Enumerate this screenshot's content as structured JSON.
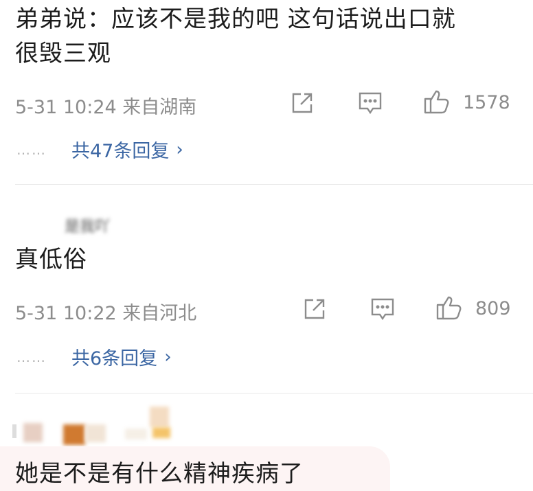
{
  "comments": [
    {
      "text_line1": "弟弟说：应该不是我的吧 这句话说出口就",
      "text_line2": "很毁三观",
      "meta": "5-31 10:24 来自湖南",
      "like_count": "1578",
      "dots": "……",
      "replies_label": "共47条回复"
    },
    {
      "username_partial": "是我吖",
      "text": "真低俗",
      "meta": "5-31 10:22 来自河北",
      "like_count": "809",
      "dots": "……",
      "replies_label": "共6条回复"
    },
    {
      "text": "她是不是有什么精神疾病了"
    }
  ],
  "icons": {
    "share": "share-icon",
    "comment": "comment-icon",
    "like": "thumbs-up-icon",
    "chevron": "chevron-right-icon"
  },
  "colors": {
    "link": "#3b66a3",
    "meta": "#8c8c8c",
    "divider": "#e8e8e8"
  }
}
